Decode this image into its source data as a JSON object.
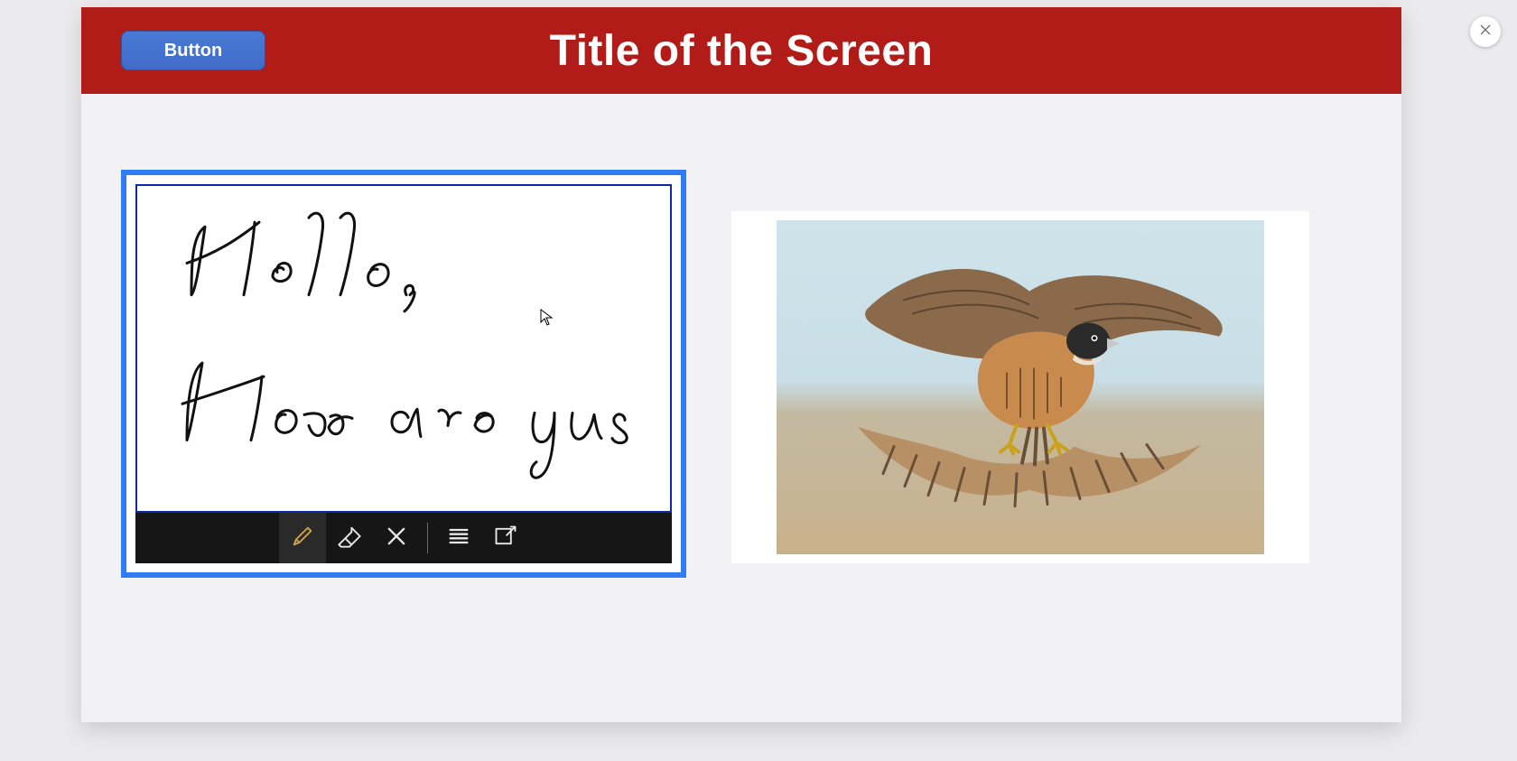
{
  "header": {
    "title": "Title of the Screen",
    "button_label": "Button"
  },
  "close": {
    "name": "close-icon"
  },
  "ink": {
    "handwritten_text": "Hello,\nHow are you",
    "toolbar": {
      "pen": "pen-icon",
      "eraser": "eraser-icon",
      "clear": "clear-icon",
      "lines": "lines-icon",
      "edit": "edit-icon",
      "active_tool": "pen"
    }
  },
  "image": {
    "description": "Falcon in flight (landing), wings spread, over blurred ground"
  }
}
